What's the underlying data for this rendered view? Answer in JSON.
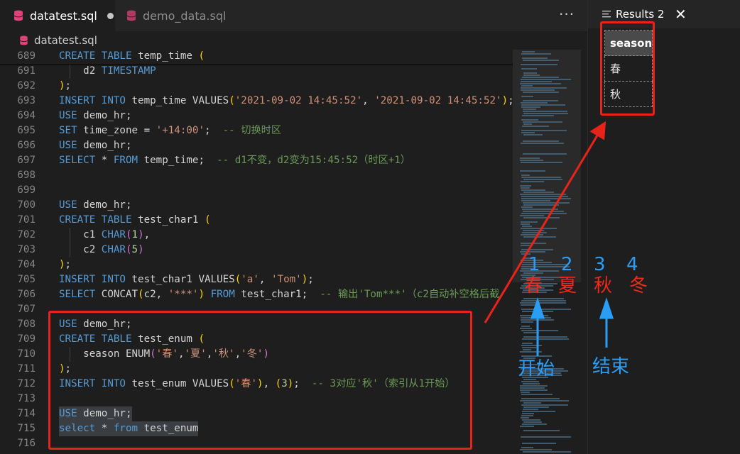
{
  "tabs": [
    {
      "label": "datatest.sql",
      "active": true,
      "dirty": true
    },
    {
      "label": "demo_data.sql",
      "active": false,
      "dirty": false
    }
  ],
  "more_actions": "···",
  "breadcrumb": "datatest.sql",
  "editor": {
    "lines": [
      {
        "num": "689",
        "guide": false,
        "tokens": [
          [
            "kw",
            "CREATE TABLE"
          ],
          [
            "plain",
            " temp_time "
          ],
          [
            "pb",
            "("
          ]
        ]
      },
      {
        "num": "691",
        "guide": true,
        "tokens": [
          [
            "plain",
            "    d2 "
          ],
          [
            "kw",
            "TIMESTAMP"
          ]
        ]
      },
      {
        "num": "692",
        "guide": false,
        "tokens": [
          [
            "pb",
            ")"
          ],
          [
            "plain",
            ";"
          ]
        ]
      },
      {
        "num": "693",
        "guide": false,
        "tokens": [
          [
            "kw",
            "INSERT INTO"
          ],
          [
            "plain",
            " temp_time VALUES"
          ],
          [
            "pb",
            "("
          ],
          [
            "str",
            "'2021-09-02 14:45:52'"
          ],
          [
            "plain",
            ", "
          ],
          [
            "str",
            "'2021-09-02 14:45:52'"
          ],
          [
            "pb",
            ")"
          ],
          [
            "plain",
            ";"
          ]
        ]
      },
      {
        "num": "694",
        "guide": false,
        "tokens": [
          [
            "kw",
            "USE"
          ],
          [
            "plain",
            " demo_hr;"
          ]
        ]
      },
      {
        "num": "695",
        "guide": false,
        "tokens": [
          [
            "kw",
            "SET"
          ],
          [
            "plain",
            " time_zone = "
          ],
          [
            "str",
            "'+14:00'"
          ],
          [
            "plain",
            ";  "
          ],
          [
            "cmt",
            "-- 切换时区"
          ]
        ]
      },
      {
        "num": "696",
        "guide": false,
        "tokens": [
          [
            "kw",
            "USE"
          ],
          [
            "plain",
            " demo_hr;"
          ]
        ]
      },
      {
        "num": "697",
        "guide": false,
        "tokens": [
          [
            "kw",
            "SELECT"
          ],
          [
            "plain",
            " * "
          ],
          [
            "kw",
            "FROM"
          ],
          [
            "plain",
            " temp_time;  "
          ],
          [
            "cmt",
            "-- d1不变，d2变为15:45:52（时区+1）"
          ]
        ]
      },
      {
        "num": "698",
        "guide": false,
        "tokens": []
      },
      {
        "num": "699",
        "guide": false,
        "tokens": []
      },
      {
        "num": "700",
        "guide": false,
        "tokens": [
          [
            "kw",
            "USE"
          ],
          [
            "plain",
            " demo_hr;"
          ]
        ]
      },
      {
        "num": "701",
        "guide": false,
        "tokens": [
          [
            "kw",
            "CREATE TABLE"
          ],
          [
            "plain",
            " test_char1 "
          ],
          [
            "pb",
            "("
          ]
        ]
      },
      {
        "num": "702",
        "guide": true,
        "tokens": [
          [
            "plain",
            "    c1 "
          ],
          [
            "kw",
            "CHAR"
          ],
          [
            "pv",
            "("
          ],
          [
            "num",
            "1"
          ],
          [
            "pv",
            ")"
          ],
          [
            "plain",
            ","
          ]
        ]
      },
      {
        "num": "703",
        "guide": true,
        "tokens": [
          [
            "plain",
            "    c2 "
          ],
          [
            "kw",
            "CHAR"
          ],
          [
            "pv",
            "("
          ],
          [
            "num",
            "5"
          ],
          [
            "pv",
            ")"
          ]
        ]
      },
      {
        "num": "704",
        "guide": false,
        "tokens": [
          [
            "pb",
            ")"
          ],
          [
            "plain",
            ";"
          ]
        ]
      },
      {
        "num": "705",
        "guide": false,
        "tokens": [
          [
            "kw",
            "INSERT INTO"
          ],
          [
            "plain",
            " test_char1 VALUES"
          ],
          [
            "pb",
            "("
          ],
          [
            "str",
            "'a'"
          ],
          [
            "plain",
            ", "
          ],
          [
            "str",
            "'Tom'"
          ],
          [
            "pb",
            ")"
          ],
          [
            "plain",
            ";"
          ]
        ]
      },
      {
        "num": "706",
        "guide": false,
        "tokens": [
          [
            "kw",
            "SELECT"
          ],
          [
            "plain",
            " CONCAT"
          ],
          [
            "pb",
            "("
          ],
          [
            "plain",
            "c2, "
          ],
          [
            "str",
            "'***'"
          ],
          [
            "pb",
            ")"
          ],
          [
            "plain",
            " "
          ],
          [
            "kw",
            "FROM"
          ],
          [
            "plain",
            " test_char1;  "
          ],
          [
            "cmt",
            "-- 输出'Tom***'（c2自动补空格后截"
          ]
        ]
      },
      {
        "num": "707",
        "guide": false,
        "tokens": []
      },
      {
        "num": "708",
        "guide": false,
        "tokens": [
          [
            "kw",
            "USE"
          ],
          [
            "plain",
            " demo_hr;"
          ]
        ]
      },
      {
        "num": "709",
        "guide": false,
        "tokens": [
          [
            "kw",
            "CREATE TABLE"
          ],
          [
            "plain",
            " test_enum "
          ],
          [
            "pb",
            "("
          ]
        ]
      },
      {
        "num": "710",
        "guide": true,
        "tokens": [
          [
            "plain",
            "    season ENUM"
          ],
          [
            "pv",
            "("
          ],
          [
            "str",
            "'春'"
          ],
          [
            "plain",
            ","
          ],
          [
            "str",
            "'夏'"
          ],
          [
            "plain",
            ","
          ],
          [
            "str",
            "'秋'"
          ],
          [
            "plain",
            ","
          ],
          [
            "str",
            "'冬'"
          ],
          [
            "pv",
            ")"
          ]
        ]
      },
      {
        "num": "711",
        "guide": false,
        "tokens": [
          [
            "pb",
            ")"
          ],
          [
            "plain",
            ";"
          ]
        ]
      },
      {
        "num": "712",
        "guide": false,
        "tokens": [
          [
            "kw",
            "INSERT INTO"
          ],
          [
            "plain",
            " test_enum VALUES"
          ],
          [
            "pb",
            "("
          ],
          [
            "str",
            "'春'"
          ],
          [
            "pb",
            ")"
          ],
          [
            "plain",
            ", "
          ],
          [
            "pb",
            "("
          ],
          [
            "num",
            "3"
          ],
          [
            "pb",
            ")"
          ],
          [
            "plain",
            ";  "
          ],
          [
            "cmt",
            "-- 3对应'秋'（索引从1开始）"
          ]
        ]
      },
      {
        "num": "713",
        "guide": false,
        "tokens": []
      },
      {
        "num": "714",
        "guide": false,
        "selected": true,
        "tokens": [
          [
            "kw",
            "USE"
          ],
          [
            "plain",
            " demo_hr;"
          ]
        ]
      },
      {
        "num": "715",
        "guide": false,
        "selected": true,
        "tokens": [
          [
            "kw",
            "select"
          ],
          [
            "plain",
            " * "
          ],
          [
            "kw",
            "from"
          ],
          [
            "plain",
            " test_enum"
          ]
        ]
      },
      {
        "num": "716",
        "guide": false,
        "tokens": []
      }
    ]
  },
  "results": {
    "title": "Results 2",
    "close": "✕",
    "column": "season",
    "rows": [
      "春",
      "秋"
    ]
  },
  "annotation": {
    "indices": [
      "1",
      "2",
      "3",
      "4"
    ],
    "seasons": [
      "春",
      "夏",
      "秋",
      "冬"
    ],
    "start_label": "开始",
    "end_label": "结束"
  },
  "colors": {
    "annotation_red": "#e8241a",
    "annotation_blue": "#2a9df4",
    "keyword": "#569cd6",
    "string": "#ce9178",
    "comment": "#6a9955"
  }
}
